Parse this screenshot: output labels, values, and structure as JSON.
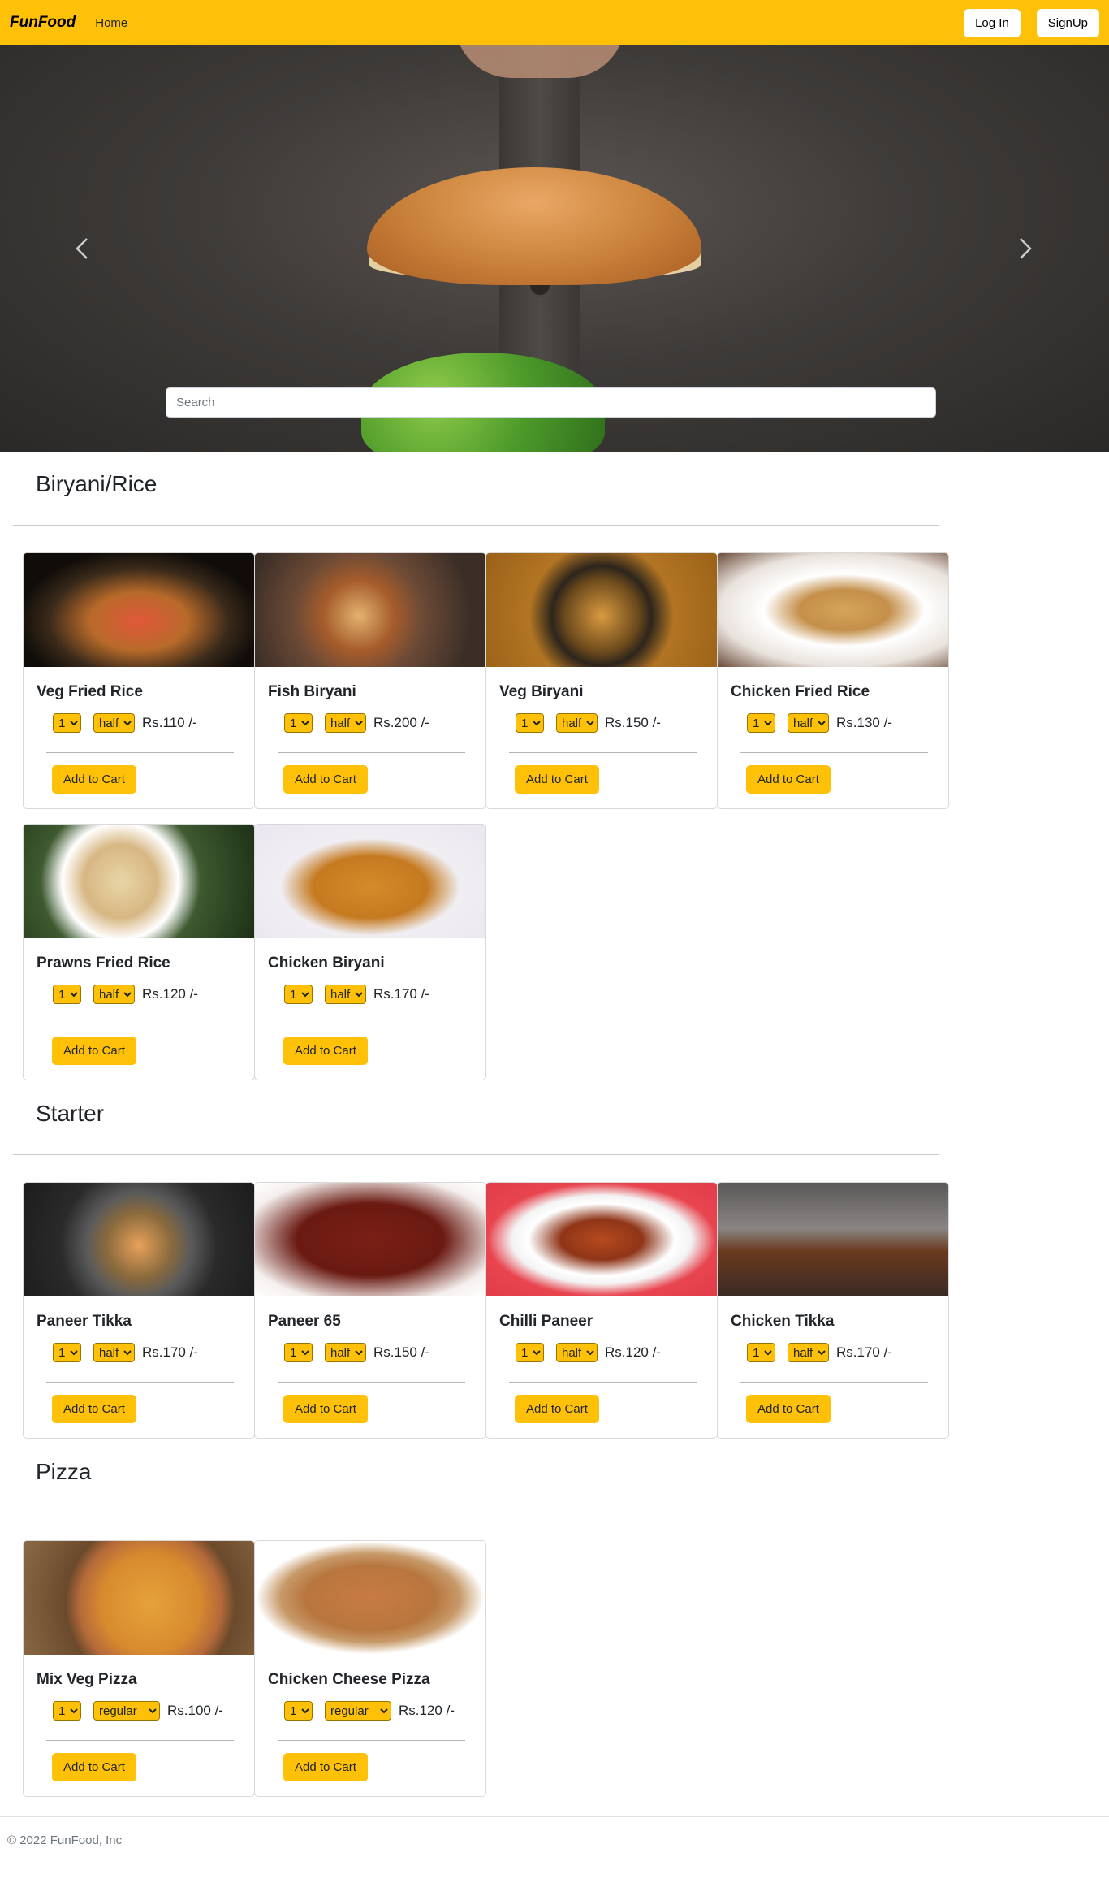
{
  "nav": {
    "brand": "FunFood",
    "home": "Home",
    "login": "Log In",
    "signup": "SignUp",
    "accent_color": "#ffc107"
  },
  "hero": {
    "search_placeholder": "Search",
    "prev_icon": "chevron-left-icon",
    "next_icon": "chevron-right-icon"
  },
  "sections": [
    {
      "title": "Biryani/Rice",
      "items": [
        {
          "name": "Veg Fried Rice",
          "qty": "1",
          "size": "half",
          "price": "Rs.110 /-"
        },
        {
          "name": "Fish Biryani",
          "qty": "1",
          "size": "half",
          "price": "Rs.200 /-"
        },
        {
          "name": "Veg Biryani",
          "qty": "1",
          "size": "half",
          "price": "Rs.150 /-"
        },
        {
          "name": "Chicken Fried Rice",
          "qty": "1",
          "size": "half",
          "price": "Rs.130 /-"
        },
        {
          "name": "Prawns Fried Rice",
          "qty": "1",
          "size": "half",
          "price": "Rs.120 /-"
        },
        {
          "name": "Chicken Biryani",
          "qty": "1",
          "size": "half",
          "price": "Rs.170 /-"
        }
      ]
    },
    {
      "title": "Starter",
      "items": [
        {
          "name": "Paneer Tikka",
          "qty": "1",
          "size": "half",
          "price": "Rs.170 /-"
        },
        {
          "name": "Paneer 65",
          "qty": "1",
          "size": "half",
          "price": "Rs.150 /-"
        },
        {
          "name": "Chilli Paneer",
          "qty": "1",
          "size": "half",
          "price": "Rs.120 /-"
        },
        {
          "name": "Chicken Tikka",
          "qty": "1",
          "size": "half",
          "price": "Rs.170 /-"
        }
      ]
    },
    {
      "title": "Pizza",
      "items": [
        {
          "name": "Mix Veg Pizza",
          "qty": "1",
          "size": "regular",
          "price": "Rs.100 /-"
        },
        {
          "name": "Chicken Cheese Pizza",
          "qty": "1",
          "size": "regular",
          "price": "Rs.120 /-"
        }
      ]
    }
  ],
  "add_to_cart_label": "Add to Cart",
  "footer": {
    "text": "© 2022 FunFood, Inc"
  }
}
